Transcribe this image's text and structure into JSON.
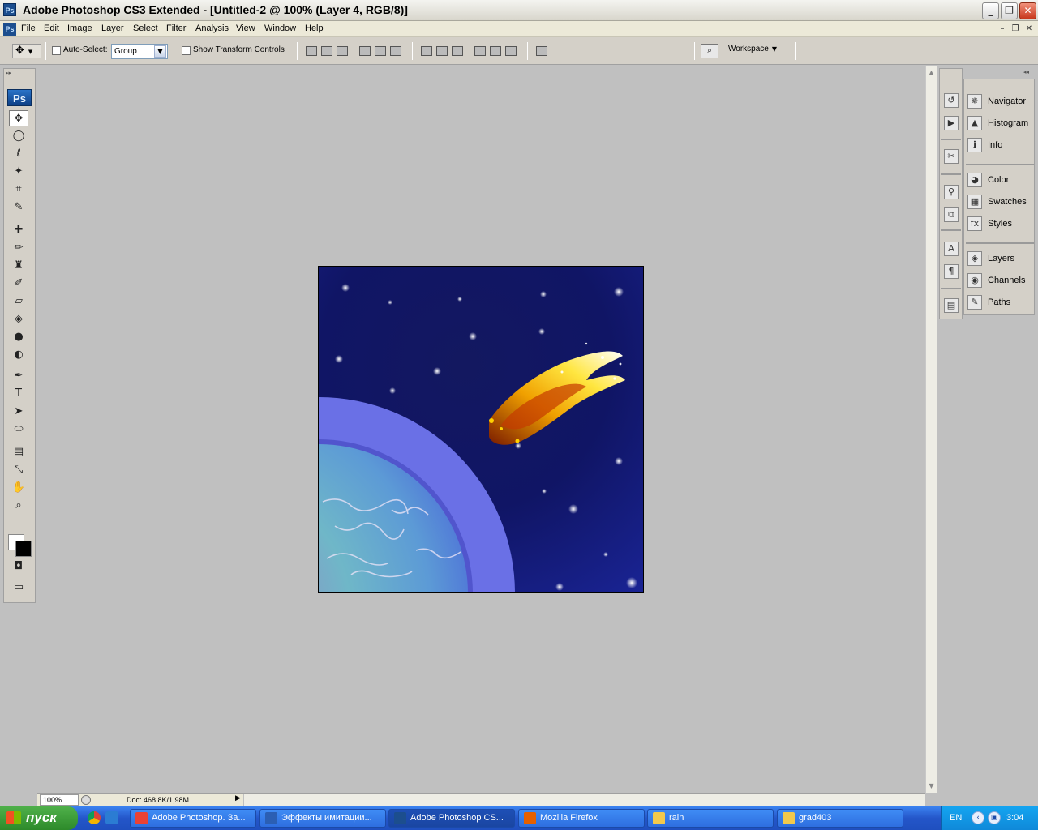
{
  "window": {
    "title": "Adobe Photoshop CS3 Extended - [Untitled-2 @ 100% (Layer 4, RGB/8)]",
    "icon_label": "Ps",
    "controls": {
      "minimize": "_",
      "maximize": "❐",
      "close": "✕"
    }
  },
  "menubar": {
    "items": [
      "File",
      "Edit",
      "Image",
      "Layer",
      "Select",
      "Filter",
      "Analysis",
      "View",
      "Window",
      "Help"
    ],
    "doc_controls": {
      "minimize": "–",
      "restore": "❐",
      "close": "✕"
    }
  },
  "options_bar": {
    "auto_select_label": "Auto-Select:",
    "auto_select_checked": false,
    "auto_select_value": "Group",
    "transform_label": "Show Transform Controls",
    "transform_checked": false,
    "workspace_label": "Workspace",
    "workspace_arrow": "▼"
  },
  "tools": {
    "logo": "Ps",
    "grip": "▸▸",
    "items": [
      {
        "name": "move-tool-icon",
        "glyph": "✥",
        "active": true
      },
      {
        "name": "marquee-tool-icon",
        "glyph": "◯"
      },
      {
        "name": "lasso-tool-icon",
        "glyph": "ℓ"
      },
      {
        "name": "magic-wand-tool-icon",
        "glyph": "✦"
      },
      {
        "name": "crop-tool-icon",
        "glyph": "⌗"
      },
      {
        "name": "slice-tool-icon",
        "glyph": "✎"
      },
      {
        "name": "healing-brush-tool-icon",
        "glyph": "✚"
      },
      {
        "name": "brush-tool-icon",
        "glyph": "✏"
      },
      {
        "name": "clone-stamp-tool-icon",
        "glyph": "♜"
      },
      {
        "name": "history-brush-tool-icon",
        "glyph": "✐"
      },
      {
        "name": "eraser-tool-icon",
        "glyph": "▱"
      },
      {
        "name": "paint-bucket-tool-icon",
        "glyph": "◈"
      },
      {
        "name": "blur-tool-icon",
        "glyph": "●"
      },
      {
        "name": "dodge-tool-icon",
        "glyph": "◐"
      },
      {
        "name": "pen-tool-icon",
        "glyph": "✒"
      },
      {
        "name": "type-tool-icon",
        "glyph": "T"
      },
      {
        "name": "path-selection-tool-icon",
        "glyph": "➤"
      },
      {
        "name": "shape-tool-icon",
        "glyph": "⬭"
      },
      {
        "name": "notes-tool-icon",
        "glyph": "▤"
      },
      {
        "name": "eyedropper-tool-icon",
        "glyph": "⤡"
      },
      {
        "name": "hand-tool-icon",
        "glyph": "✋"
      },
      {
        "name": "zoom-tool-icon",
        "glyph": "⌕"
      },
      {
        "name": "quick-mask-icon",
        "glyph": "◘"
      },
      {
        "name": "screen-mode-icon",
        "glyph": "▭"
      }
    ]
  },
  "status_bar": {
    "zoom": "100%",
    "doc_info": "Doc: 468,8K/1,98M",
    "arrow": "▶"
  },
  "panels": {
    "strip_icons": [
      {
        "name": "history-panel-icon",
        "glyph": "↺"
      },
      {
        "name": "actions-panel-icon",
        "glyph": "▶"
      },
      {
        "name": "tool-presets-panel-icon",
        "glyph": "✂"
      },
      {
        "name": "brushes-panel-icon",
        "glyph": "⚲"
      },
      {
        "name": "clone-source-panel-icon",
        "glyph": "⧉"
      },
      {
        "name": "character-panel-icon",
        "glyph": "A"
      },
      {
        "name": "paragraph-panel-icon",
        "glyph": "¶"
      },
      {
        "name": "layer-comps-panel-icon",
        "glyph": "▤"
      }
    ],
    "groups": [
      [
        {
          "label": "Navigator",
          "glyph": "✵",
          "name": "navigator"
        },
        {
          "label": "Histogram",
          "glyph": "▲",
          "name": "histogram"
        },
        {
          "label": "Info",
          "glyph": "ℹ",
          "name": "info"
        }
      ],
      [
        {
          "label": "Color",
          "glyph": "◕",
          "name": "color"
        },
        {
          "label": "Swatches",
          "glyph": "▦",
          "name": "swatches"
        },
        {
          "label": "Styles",
          "glyph": "fx",
          "name": "styles"
        }
      ],
      [
        {
          "label": "Layers",
          "glyph": "◈",
          "name": "layers"
        },
        {
          "label": "Channels",
          "glyph": "◉",
          "name": "channels"
        },
        {
          "label": "Paths",
          "glyph": "✎",
          "name": "paths"
        }
      ]
    ]
  },
  "taskbar": {
    "start_label": "пуск",
    "tasks": [
      {
        "label": "Adobe Photoshop. За...",
        "icon_color": "#e94235",
        "active": false
      },
      {
        "label": "Эффекты имитации...",
        "icon_color": "#2b5fb4",
        "active": false
      },
      {
        "label": "Adobe Photoshop CS...",
        "icon_color": "#1c4e8e",
        "active": true
      },
      {
        "label": "Mozilla Firefox",
        "icon_color": "#e66000",
        "active": false
      },
      {
        "label": "rain",
        "icon_color": "#f2c94c",
        "active": false
      },
      {
        "label": "grad403",
        "icon_color": "#f2c94c",
        "active": false
      }
    ],
    "lang": "EN",
    "clock": "3:04"
  },
  "colors": {
    "workspace_bg": "#c0c0c0",
    "panel_bg": "#d4d0c8",
    "taskbar_blue": "#2456c9",
    "start_green": "#3a9a36",
    "foreground_swatch": "#ffffff",
    "background_swatch": "#000000"
  }
}
